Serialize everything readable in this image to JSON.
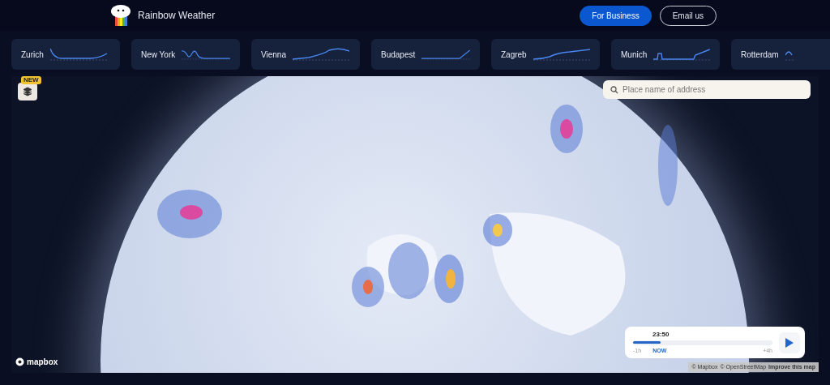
{
  "header": {
    "brand": "Rainbow Weather",
    "buttons": [
      {
        "label": "For Business",
        "kind": "primary"
      },
      {
        "label": "Email us",
        "kind": "outline"
      }
    ]
  },
  "cities": [
    {
      "name": "Zurich"
    },
    {
      "name": "New York"
    },
    {
      "name": "Vienna"
    },
    {
      "name": "Budapest"
    },
    {
      "name": "Zagreb"
    },
    {
      "name": "Munich"
    },
    {
      "name": "Rotterdam"
    }
  ],
  "map": {
    "layers_badge": "NEW",
    "search": {
      "placeholder": "Place name of address"
    },
    "logo": "mapbox",
    "attribution": [
      "© Mapbox",
      "© OpenStreetMap"
    ],
    "improve_link": "Improve this map"
  },
  "timeline": {
    "time": "23:50",
    "level": 0.2,
    "labels": [
      "-1h",
      "NOW",
      "+4h"
    ]
  }
}
